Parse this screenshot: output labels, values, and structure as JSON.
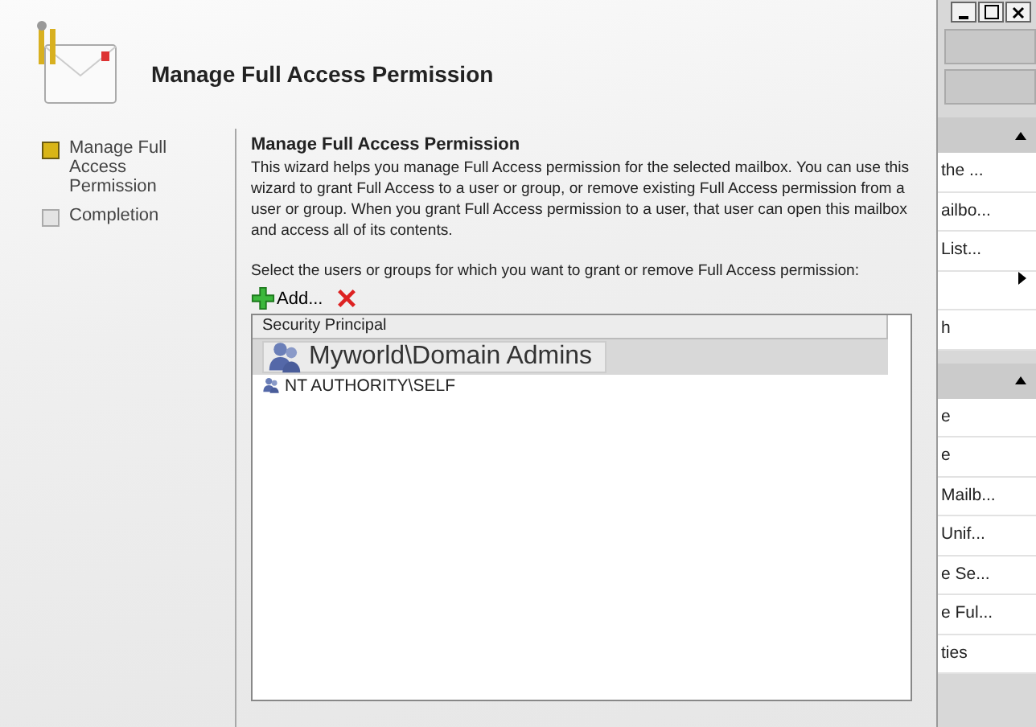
{
  "wizard": {
    "title": "Manage Full Access Permission",
    "steps": [
      {
        "label": "Manage Full Access Permission",
        "selected": true
      },
      {
        "label": "Completion",
        "selected": false
      }
    ],
    "heading": "Manage Full Access Permission",
    "description": "This wizard helps you manage Full Access permission for the selected mailbox. You can use this wizard to grant Full Access to a user or group, or remove existing Full Access permission from a user or group. When you grant Full Access permission to a user, that user can open this mailbox and access all of its contents.",
    "prompt": "Select the users or groups for which you want to grant or remove Full Access permission:",
    "add_label": "Add...",
    "column": "Security Principal",
    "rows": [
      {
        "selected": true
      },
      {
        "name": "NT AUTHORITY\\SELF",
        "selected": false
      }
    ],
    "drag_preview": "Myworld\\Domain Admins"
  },
  "actions_pane": {
    "sections": [
      {
        "items": [
          {
            "label": "the ...",
            "kind": "text"
          },
          {
            "label": "ailbo...",
            "kind": "text"
          },
          {
            "label": "List...",
            "kind": "text"
          },
          {
            "kind": "submenu"
          },
          {
            "label": "h",
            "kind": "text"
          }
        ]
      },
      {
        "items": [
          {
            "label": "e",
            "kind": "text"
          },
          {
            "label": "e",
            "kind": "text"
          },
          {
            "label": "Mailb...",
            "kind": "text"
          },
          {
            "label": "Unif...",
            "kind": "text"
          },
          {
            "label": "e Se...",
            "kind": "text"
          },
          {
            "label": "e Ful...",
            "kind": "text"
          },
          {
            "label": "ties",
            "kind": "text"
          }
        ]
      }
    ]
  }
}
